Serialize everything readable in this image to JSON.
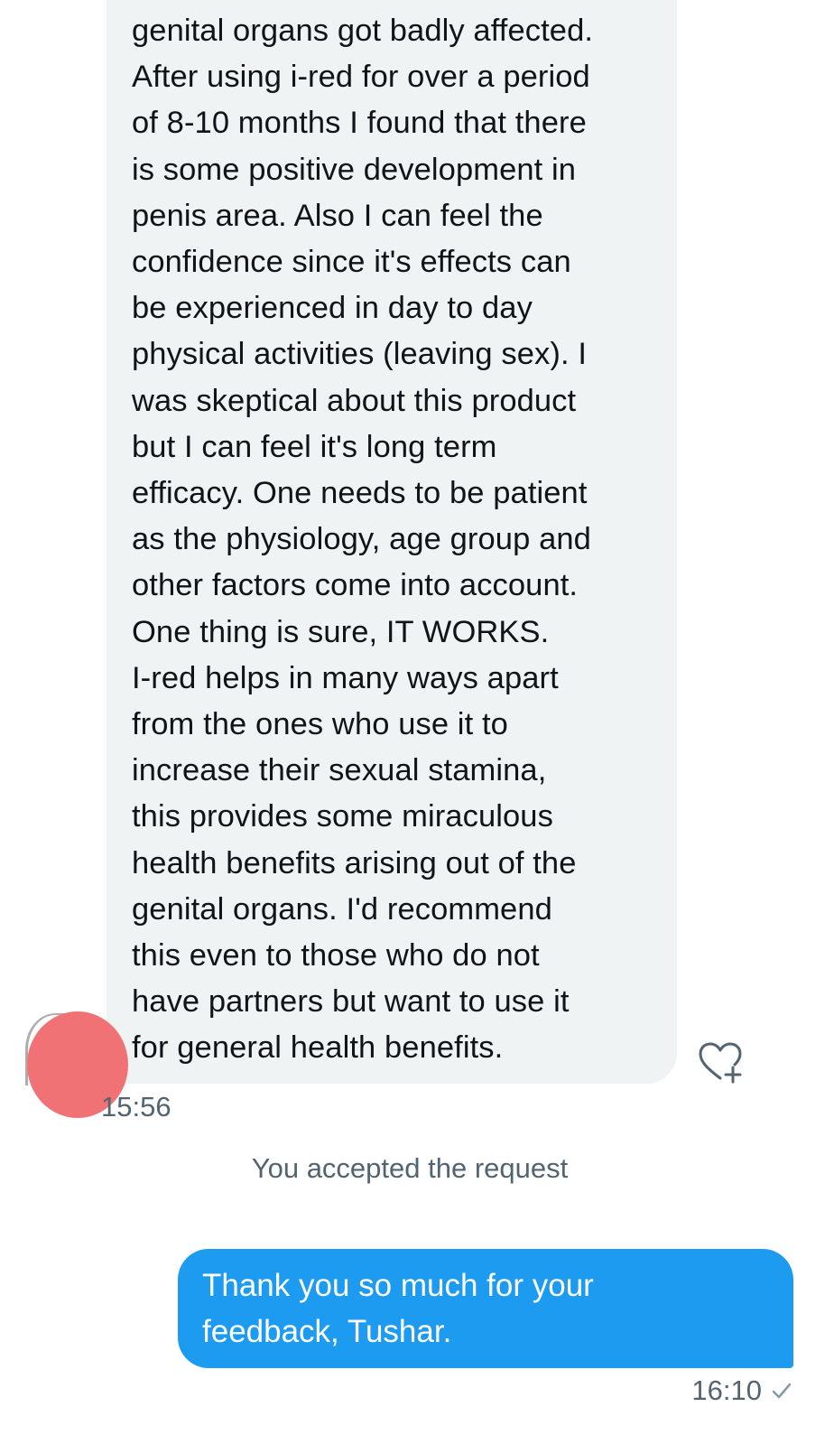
{
  "received_message": {
    "text": "genital organs got badly affected.\nAfter using i-red for over a period\nof 8-10 months I found that there\nis some positive development in\npenis area. Also I can feel the\nconfidence since it's effects can\nbe experienced in day to day\nphysical activities (leaving sex). I\nwas skeptical about this product\nbut I can feel it's long term\nefficacy. One needs to be patient\nas the physiology, age group and\nother factors come into account.\nOne thing is sure, IT WORKS.\nI-red helps in many ways apart\nfrom the ones who use it to\nincrease their sexual stamina,\nthis provides some  miraculous\nhealth benefits arising out of the\ngenital organs. I'd recommend\nthis even to those who do not\nhave partners but want to use it\nfor general health benefits.",
    "timestamp": "15:56",
    "bubble_color": "#eff3f4",
    "reaction_icon": "heart-plus-icon"
  },
  "avatar": {
    "redaction_color": "#f07275"
  },
  "system_notice": {
    "text": "You accepted the request"
  },
  "sent_message": {
    "text": "Thank you so much for your\nfeedback, Tushar.",
    "timestamp": "16:10",
    "status_icon": "check-icon",
    "bubble_color": "#1d9bf0"
  }
}
